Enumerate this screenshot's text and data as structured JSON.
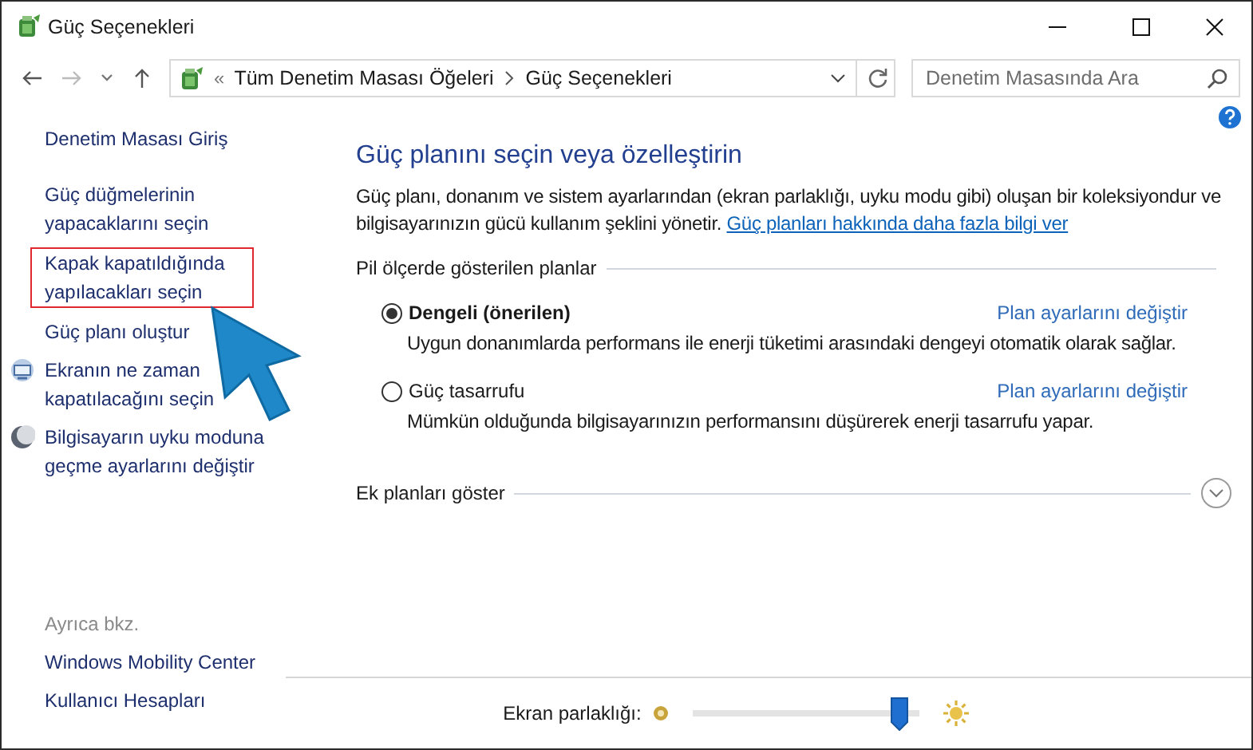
{
  "window": {
    "title": "Güç Seçenekleri"
  },
  "address_bar": {
    "overflow": "«",
    "path": [
      "Tüm Denetim Masası Öğeleri",
      "Güç Seçenekleri"
    ]
  },
  "search": {
    "placeholder": "Denetim Masasında Ara"
  },
  "sidebar": {
    "items": [
      {
        "label": "Denetim Masası Giriş",
        "kind": "plain",
        "highlighted": false
      },
      {
        "label": "Güç düğmelerinin yapacaklarını seçin",
        "kind": "plain",
        "highlighted": false
      },
      {
        "label": "Kapak kapatıldığında yapılacakları seçin",
        "kind": "plain",
        "highlighted": true
      },
      {
        "label": "Güç planı oluştur",
        "kind": "plain",
        "highlighted": false
      },
      {
        "label": "Ekranın ne zaman kapatılacağını seçin",
        "kind": "display",
        "highlighted": false
      },
      {
        "label": "Bilgisayarın uyku moduna geçme ayarlarını değiştir",
        "kind": "sleep",
        "highlighted": false
      }
    ],
    "see_also": {
      "title": "Ayrıca bkz.",
      "links": [
        "Windows Mobility Center",
        "Kullanıcı Hesapları"
      ]
    }
  },
  "main": {
    "heading": "Güç planını seçin veya özelleştirin",
    "description": "Güç planı, donanım ve sistem ayarlarından (ekran parlaklığı, uyku modu gibi) oluşan bir koleksiyondur ve bilgisayarınızın gücü kullanım şeklini yönetir.",
    "description_link": "Güç planları hakkında daha fazla bilgi ver",
    "plans_group": "Pil ölçerde gösterilen planlar",
    "plans": [
      {
        "name": "Dengeli (önerilen)",
        "selected": true,
        "settings_link": "Plan ayarlarını değiştir",
        "description": "Uygun donanımlarda performans ile enerji tüketimi arasındaki dengeyi otomatik olarak sağlar."
      },
      {
        "name": "Güç tasarrufu",
        "selected": false,
        "settings_link": "Plan ayarlarını değiştir",
        "description": "Mümkün olduğunda bilgisayarınızın performansını düşürerek enerji tasarrufu yapar."
      }
    ],
    "more_plans": {
      "label": "Ek planları göster",
      "expanded": false
    },
    "brightness": {
      "label": "Ekran parlaklığı:",
      "level": 0.95
    }
  }
}
